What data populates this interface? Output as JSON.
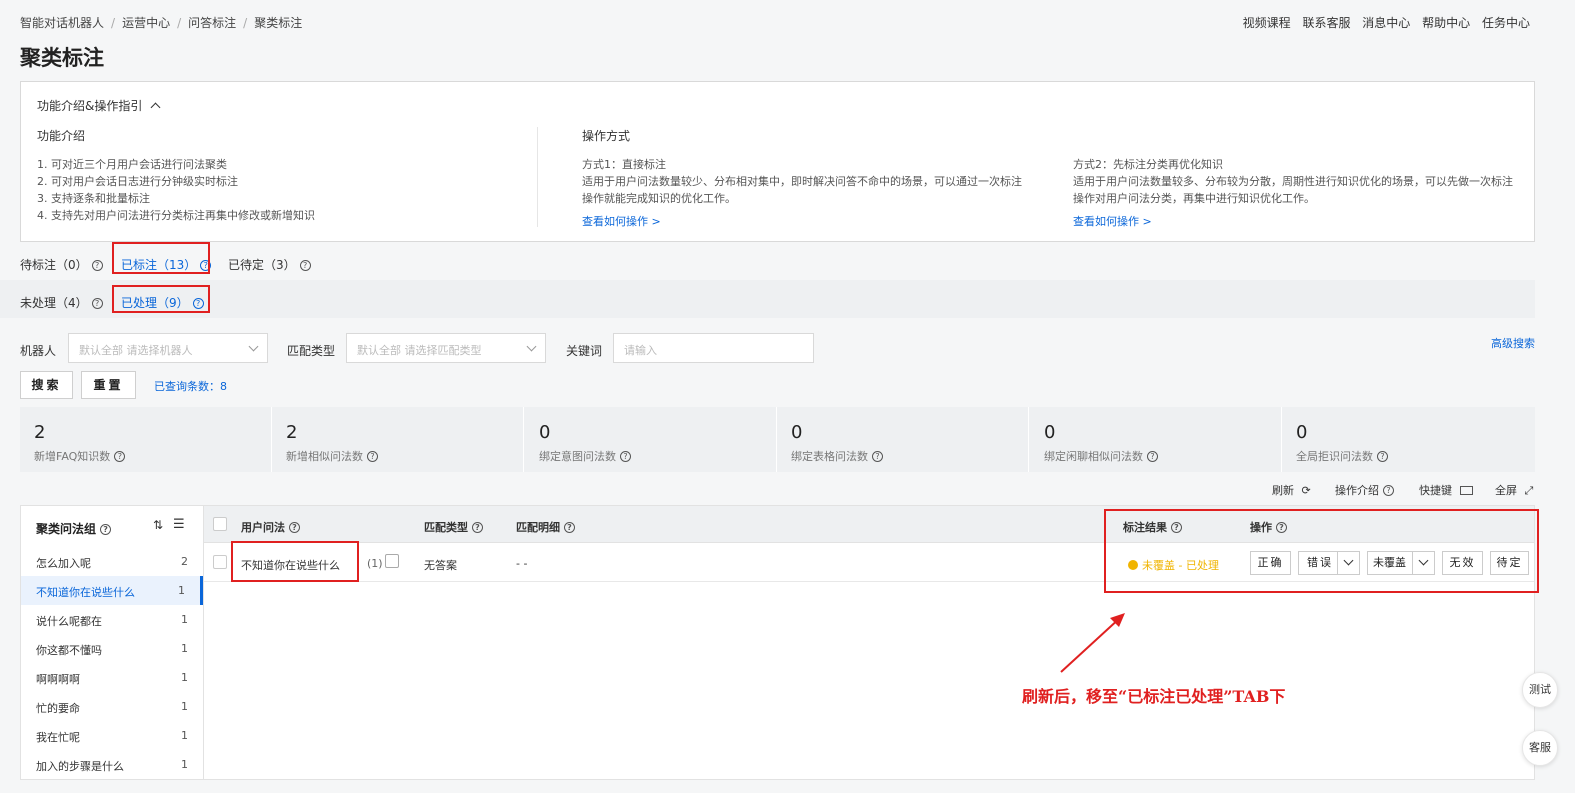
{
  "breadcrumb": [
    "智能对话机器人",
    "运营中心",
    "问答标注",
    "聚类标注"
  ],
  "topnav": [
    "视频课程",
    "联系客服",
    "消息中心",
    "帮助中心",
    "任务中心"
  ],
  "page_title": "聚类标注",
  "intro": {
    "header": "功能介绍&操作指引",
    "features_title": "功能介绍",
    "features": [
      "1. 可对近三个月用户会话进行问法聚类",
      "2. 可对用户会话日志进行分钟级实时标注",
      "3. 支持逐条和批量标注",
      "4. 支持先对用户问法进行分类标注再集中修改或新增知识"
    ],
    "ops_title": "操作方式",
    "method1_title": "方式1：直接标注",
    "method1_desc_1": "适用于用户问法数量较少、分布相对集中，即时解决问答不命中的场景，可以通过一次标注",
    "method1_desc_2": "操作就能完成知识的优化工作。",
    "method1_link": "查看如何操作 >",
    "method2_title": "方式2：先标注分类再优化知识",
    "method2_desc_1": "适用于用户问法数量较多、分布较为分散，周期性进行知识优化的场景，可以先做一次标注",
    "method2_desc_2": "操作对用户问法分类，再集中进行知识优化工作。",
    "method2_link": "查看如何操作 >"
  },
  "tabs": {
    "pending": "待标注（0）",
    "labeled": "已标注（13）",
    "undecided": "已待定（3）"
  },
  "subtabs": {
    "unprocessed": "未处理（4）",
    "processed": "已处理（9）"
  },
  "filters": {
    "robot_label": "机器人",
    "robot_placeholder": "默认全部 请选择机器人",
    "match_label": "匹配类型",
    "match_placeholder": "默认全部 请选择匹配类型",
    "keyword_label": "关键词",
    "keyword_placeholder": "请输入",
    "advanced": "高级搜索",
    "search_btn": "搜索",
    "reset_btn": "重置",
    "result_count": "已查询条数：8"
  },
  "stats": [
    {
      "value": "2",
      "label": "新增FAQ知识数"
    },
    {
      "value": "2",
      "label": "新增相似问法数"
    },
    {
      "value": "0",
      "label": "绑定意图问法数"
    },
    {
      "value": "0",
      "label": "绑定表格问法数"
    },
    {
      "value": "0",
      "label": "绑定闲聊相似问法数"
    },
    {
      "value": "0",
      "label": "全局拒识问法数"
    }
  ],
  "toolbar": {
    "refresh": "刷新",
    "guide": "操作介绍",
    "shortcut": "快捷键",
    "fullscreen": "全屏"
  },
  "sidebar": {
    "title": "聚类问法组",
    "items": [
      {
        "label": "怎么加入呢",
        "count": "2"
      },
      {
        "label": "不知道你在说些什么",
        "count": "1"
      },
      {
        "label": "说什么呢都在",
        "count": "1"
      },
      {
        "label": "你这都不懂吗",
        "count": "1"
      },
      {
        "label": "啊啊啊啊",
        "count": "1"
      },
      {
        "label": "忙的要命",
        "count": "1"
      },
      {
        "label": "我在忙呢",
        "count": "1"
      },
      {
        "label": "加入的步骤是什么",
        "count": "1"
      }
    ]
  },
  "table": {
    "headers": {
      "question": "用户问法",
      "match_type": "匹配类型",
      "match_detail": "匹配明细",
      "result": "标注结果",
      "ops": "操作"
    },
    "rows": [
      {
        "question": "不知道你在说些什么",
        "count": "(1)",
        "match_type": "无答案",
        "match_detail": "- -",
        "result": "未覆盖 - 已处理"
      }
    ],
    "ops_buttons": {
      "correct": "正确",
      "wrong": "错误",
      "uncovered": "未覆盖",
      "invalid": "无效",
      "pending": "待定"
    }
  },
  "annotation": "刷新后，移至“已标注已处理”TAB下",
  "float_buttons": {
    "test": "测试",
    "service": "客服"
  },
  "colors": {
    "accent": "#0a66d9",
    "highlight": "#e02020",
    "warning": "#f0b400"
  }
}
